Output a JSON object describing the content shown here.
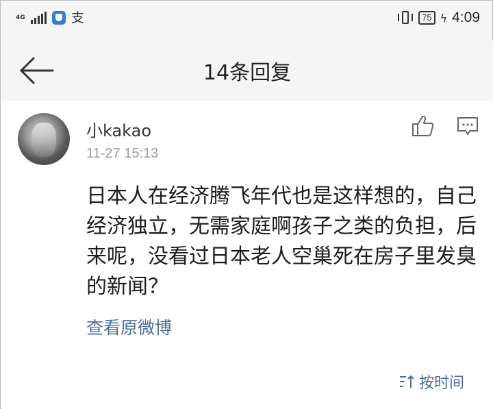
{
  "status_bar": {
    "network_label": "4G",
    "signal_icon": "signal-bars-icon",
    "app_icons": [
      "security-shield-icon",
      "alipay-icon"
    ],
    "alipay_glyph": "支",
    "vibrate_icon": "vibrate-icon",
    "battery_level": "75",
    "charging_icon": "bolt-icon",
    "time": "4:09"
  },
  "nav": {
    "back_icon": "arrow-left-icon",
    "title": "14条回复"
  },
  "comment": {
    "username": "小kakao",
    "timestamp": "11-27 15:13",
    "text": "日本人在经济腾飞年代也是这样想的，自己经济独立，无需家庭啊孩子之类的负担，后来呢，没看过日本老人空巢死在房子里发臭的新闻？",
    "like_icon": "thumbs-up-icon",
    "reply_icon": "comment-bubble-icon",
    "view_original_label": "查看原微博"
  },
  "footer": {
    "sort_icon": "sort-icon",
    "sort_label": "按时间"
  },
  "colors": {
    "link": "#4a6e9a",
    "timestamp": "#9b9b9b",
    "background": "#f5f5f5",
    "card": "#ffffff"
  }
}
